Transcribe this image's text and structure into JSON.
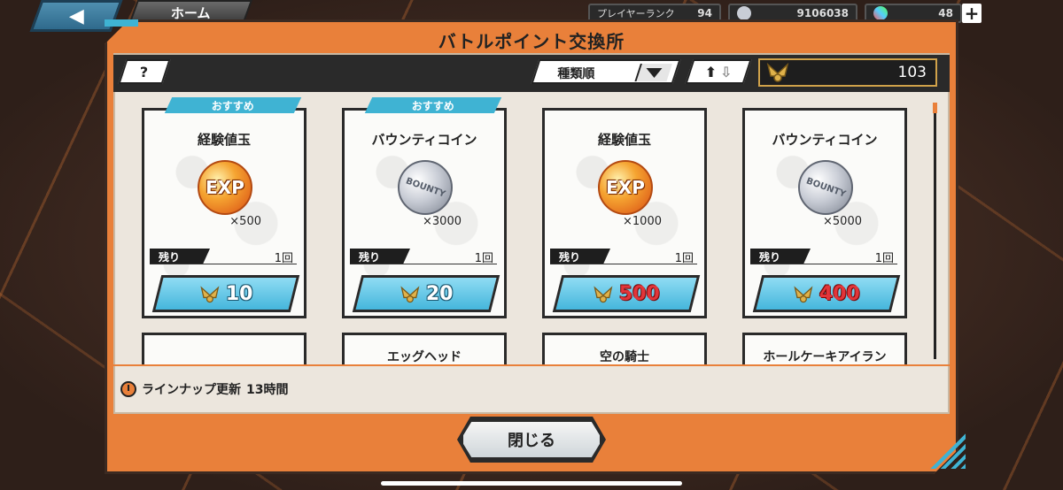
{
  "hud": {
    "back_icon": "left-arrow-icon",
    "home_label": "ホーム",
    "player_rank_label": "プレイヤーランク",
    "player_rank_value": "94",
    "currency_value": "9106038",
    "gems_value": "48",
    "plus_label": "+"
  },
  "dialog": {
    "title": "バトルポイント交換所",
    "help_label": "?",
    "sort_label": "種類順",
    "points_value": "103",
    "lineup_label": "ラインナップ更新",
    "lineup_time": "13時間",
    "close_label": "閉じる"
  },
  "cards": [
    {
      "badge": "おすすめ",
      "name": "経験値玉",
      "icon": "exp-orb-icon",
      "icon_text": "EXP",
      "qty": "×500",
      "remain_label": "残り",
      "remain_value": "1回",
      "cost": "10",
      "affordable": true
    },
    {
      "badge": "おすすめ",
      "name": "バウンティコイン",
      "icon": "bounty-coin-icon",
      "icon_text": "BOUNTY",
      "qty": "×3000",
      "remain_label": "残り",
      "remain_value": "1回",
      "cost": "20",
      "affordable": true
    },
    {
      "badge": "",
      "name": "経験値玉",
      "icon": "exp-orb-icon",
      "icon_text": "EXP",
      "qty": "×1000",
      "remain_label": "残り",
      "remain_value": "1回",
      "cost": "500",
      "affordable": false
    },
    {
      "badge": "",
      "name": "バウンティコイン",
      "icon": "bounty-coin-icon",
      "icon_text": "BOUNTY",
      "qty": "×5000",
      "remain_label": "残り",
      "remain_value": "1回",
      "cost": "400",
      "affordable": false
    }
  ],
  "next_cards": [
    {
      "name": ""
    },
    {
      "name": "エッグヘッド"
    },
    {
      "name": "空の騎士"
    },
    {
      "name": "ホールケーキアイラン"
    }
  ],
  "colors": {
    "frame": "#e9803a",
    "accent": "#3fb3d3",
    "cost_unaffordable": "#e2353a"
  }
}
